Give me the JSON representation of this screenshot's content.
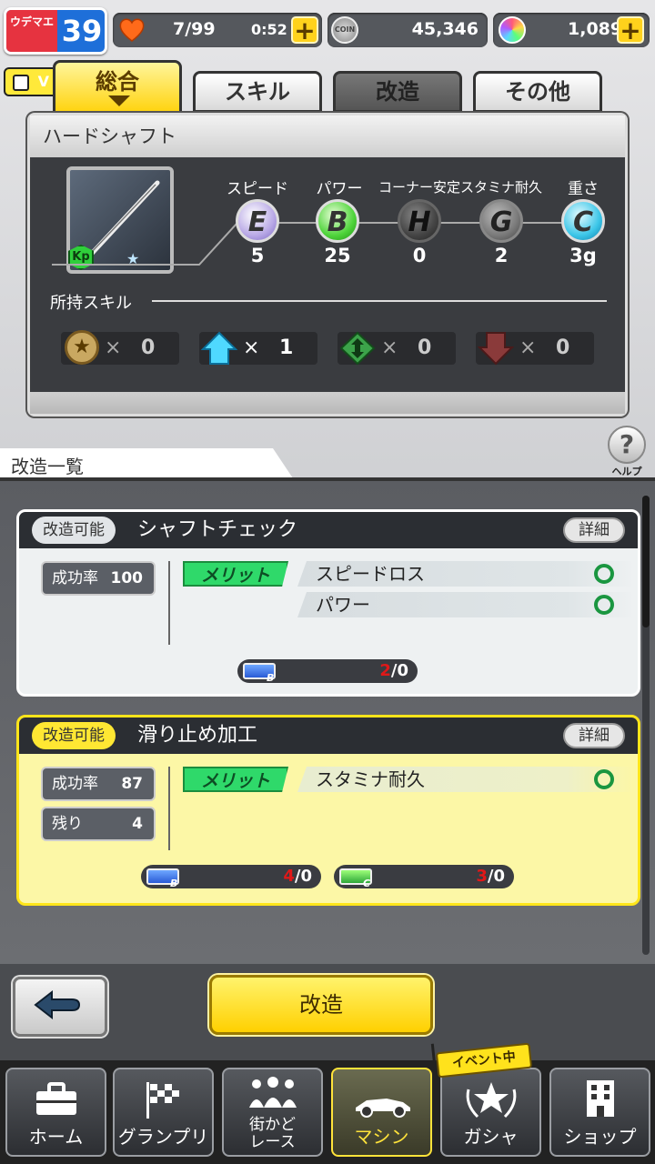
{
  "status": {
    "rank_label": "ウデマエ",
    "rank_value": "39",
    "stamina": "7/99",
    "timer": "0:52",
    "coins": "45,346",
    "gems": "1,089"
  },
  "vchip": "V",
  "tabs": [
    {
      "label": "総合"
    },
    {
      "label": "スキル"
    },
    {
      "label": "改造"
    },
    {
      "label": "その他"
    }
  ],
  "part": {
    "name": "ハードシャフト",
    "badge": "Kp",
    "stats": [
      {
        "label": "スピード",
        "grade": "E",
        "value": "5",
        "color": "#b9a9e6"
      },
      {
        "label": "パワー",
        "grade": "B",
        "value": "25",
        "color": "#4fd43b"
      },
      {
        "label": "コーナー安定",
        "grade": "H",
        "value": "0",
        "color": "#555555"
      },
      {
        "label": "スタミナ耐久",
        "grade": "G",
        "value": "2",
        "color": "#7a7a7a"
      },
      {
        "label": "重さ",
        "grade": "C",
        "value": "3g",
        "color": "#3cc6e8"
      }
    ],
    "skills_label": "所持スキル",
    "skills": [
      {
        "icon": "star-icon",
        "count": "0"
      },
      {
        "icon": "arrow-up-icon",
        "count": "1"
      },
      {
        "icon": "diamond-arrows-icon",
        "count": "0"
      },
      {
        "icon": "arrow-down-icon",
        "count": "0"
      }
    ]
  },
  "list_title": "改造一覧",
  "help_label": "ヘルプ",
  "mods": [
    {
      "badge": "改造可能",
      "title": "シャフトチェック",
      "detail": "詳細",
      "rate_label": "成功率",
      "rate": "100",
      "merit": "メリット",
      "effects": [
        "スピードロス",
        "パワー"
      ],
      "materials": [
        {
          "grade": "B",
          "have": "2",
          "need": "/0"
        }
      ]
    },
    {
      "badge": "改造可能",
      "title": "滑り止め加工",
      "detail": "詳細",
      "rate_label": "成功率",
      "rate": "87",
      "remain_label": "残り",
      "remain": "4",
      "merit": "メリット",
      "effects": [
        "スタミナ耐久"
      ],
      "materials": [
        {
          "grade": "B",
          "have": "4",
          "need": "/0"
        },
        {
          "grade": "C",
          "have": "3",
          "need": "/0"
        }
      ]
    }
  ],
  "actions": {
    "kaizo": "改造"
  },
  "event_badge": "イベント中",
  "nav": [
    {
      "label": "ホーム"
    },
    {
      "label": "グランプリ"
    },
    {
      "label": "街かど\nレース"
    },
    {
      "label": "マシン"
    },
    {
      "label": "ガシャ"
    },
    {
      "label": "ショップ"
    }
  ]
}
